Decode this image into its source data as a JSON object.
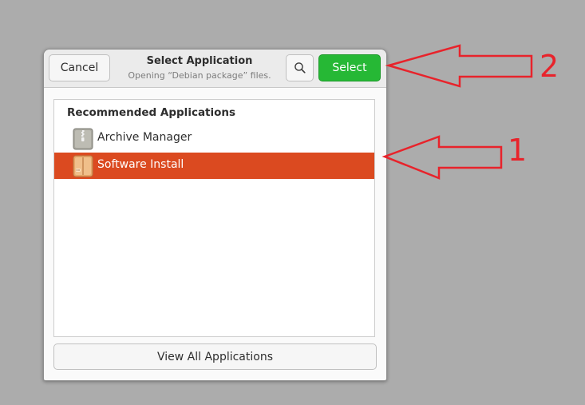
{
  "dialog": {
    "title": "Select Application",
    "subtitle": "Opening “Debian package” files.",
    "cancel_label": "Cancel",
    "select_label": "Select",
    "search_icon": "search-icon"
  },
  "list": {
    "heading": "Recommended Applications",
    "items": [
      {
        "label": "Archive Manager",
        "icon": "archive-manager-icon",
        "selected": false
      },
      {
        "label": "Software Install",
        "icon": "software-install-icon",
        "selected": true
      }
    ]
  },
  "footer": {
    "view_all_label": "View All Applications"
  },
  "annotations": {
    "arrow_1_label": "1",
    "arrow_2_label": "2",
    "color": "#e8232b"
  },
  "colors": {
    "select_button": "#26b835",
    "selected_row": "#db4a20"
  }
}
